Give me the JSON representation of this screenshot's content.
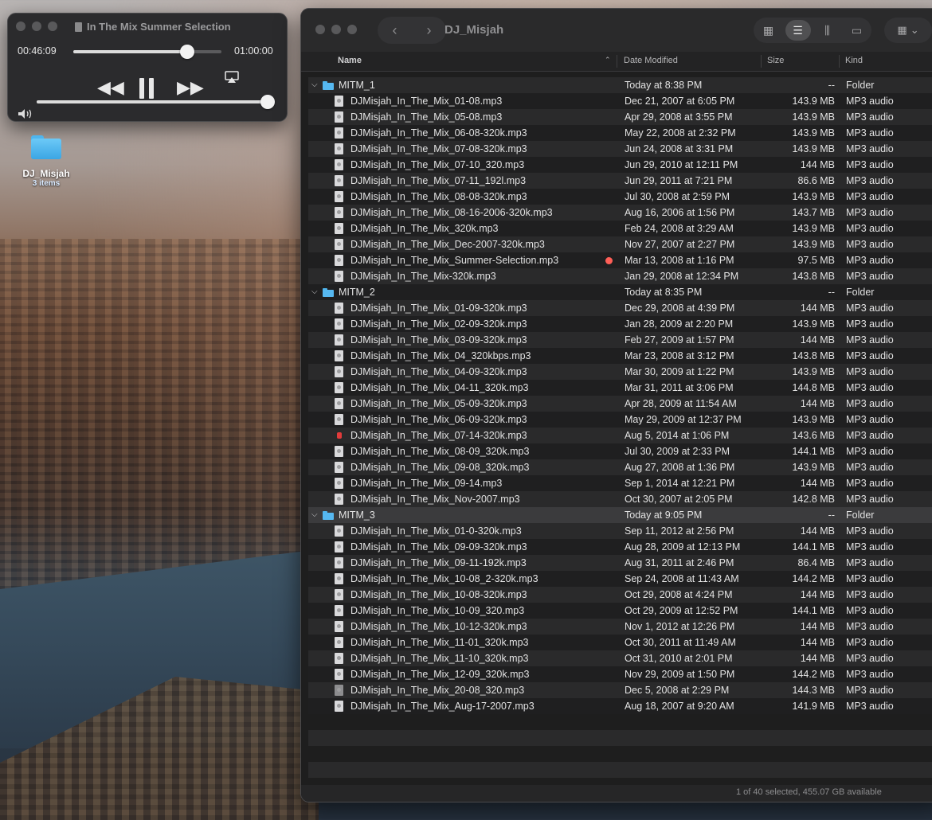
{
  "player": {
    "title": "In The Mix Summer Selection",
    "elapsed": "00:46:09",
    "duration": "01:00:00",
    "progress_fraction": 0.77,
    "volume_fraction": 1.0,
    "icons": {
      "rewind": "rewind-icon",
      "pause": "pause-icon",
      "forward": "fast-forward-icon",
      "airplay": "airplay-icon",
      "volume": "volume-icon"
    }
  },
  "desktop": {
    "folder_name": "DJ_Misjah",
    "folder_count": "3 items"
  },
  "finder": {
    "title": "DJ_Misjah",
    "columns": {
      "name": "Name",
      "date": "Date Modified",
      "size": "Size",
      "kind": "Kind"
    },
    "status": "1 of 40 selected, 455.07 GB available",
    "rows": [
      {
        "type": "folder",
        "name": "MITM_1",
        "date": "Today at 8:38 PM",
        "size": "--",
        "kind": "Folder"
      },
      {
        "type": "file",
        "name": "DJMisjah_In_The_Mix_01-08.mp3",
        "date": "Dec 21, 2007 at 6:05 PM",
        "size": "143.9 MB",
        "kind": "MP3 audio"
      },
      {
        "type": "file",
        "name": "DJMisjah_In_The_Mix_05-08.mp3",
        "date": "Apr 29, 2008 at 3:55 PM",
        "size": "143.9 MB",
        "kind": "MP3 audio"
      },
      {
        "type": "file",
        "name": "DJMisjah_In_The_Mix_06-08-320k.mp3",
        "date": "May 22, 2008 at 2:32 PM",
        "size": "143.9 MB",
        "kind": "MP3 audio"
      },
      {
        "type": "file",
        "name": "DJMisjah_In_The_Mix_07-08-320k.mp3",
        "date": "Jun 24, 2008 at 3:31 PM",
        "size": "143.9 MB",
        "kind": "MP3 audio"
      },
      {
        "type": "file",
        "name": "DJMisjah_In_The_Mix_07-10_320.mp3",
        "date": "Jun 29, 2010 at 12:11 PM",
        "size": "144 MB",
        "kind": "MP3 audio"
      },
      {
        "type": "file",
        "name": "DJMisjah_In_The_Mix_07-11_192l.mp3",
        "date": "Jun 29, 2011 at 7:21 PM",
        "size": "86.6 MB",
        "kind": "MP3 audio"
      },
      {
        "type": "file",
        "name": "DJMisjah_In_The_Mix_08-08-320k.mp3",
        "date": "Jul 30, 2008 at 2:59 PM",
        "size": "143.9 MB",
        "kind": "MP3 audio"
      },
      {
        "type": "file",
        "name": "DJMisjah_In_The_Mix_08-16-2006-320k.mp3",
        "date": "Aug 16, 2006 at 1:56 PM",
        "size": "143.7 MB",
        "kind": "MP3 audio"
      },
      {
        "type": "file",
        "name": "DJMisjah_In_The_Mix_320k.mp3",
        "date": "Feb 24, 2008 at 3:29 AM",
        "size": "143.9 MB",
        "kind": "MP3 audio"
      },
      {
        "type": "file",
        "name": "DJMisjah_In_The_Mix_Dec-2007-320k.mp3",
        "date": "Nov 27, 2007 at 2:27 PM",
        "size": "143.9 MB",
        "kind": "MP3 audio"
      },
      {
        "type": "file",
        "name": "DJMisjah_In_The_Mix_Summer-Selection.mp3",
        "date": "Mar 13, 2008 at 1:16 PM",
        "size": "97.5 MB",
        "kind": "MP3 audio",
        "tag": "red"
      },
      {
        "type": "file",
        "name": "DJMisjah_In_The_Mix-320k.mp3",
        "date": "Jan 29, 2008 at 12:34 PM",
        "size": "143.8 MB",
        "kind": "MP3 audio"
      },
      {
        "type": "folder",
        "name": "MITM_2",
        "date": "Today at 8:35 PM",
        "size": "--",
        "kind": "Folder"
      },
      {
        "type": "file",
        "name": "DJMisjah_In_The_Mix_01-09-320k.mp3",
        "date": "Dec 29, 2008 at 4:39 PM",
        "size": "144 MB",
        "kind": "MP3 audio"
      },
      {
        "type": "file",
        "name": "DJMisjah_In_The_Mix_02-09-320k.mp3",
        "date": "Jan 28, 2009 at 2:20 PM",
        "size": "143.9 MB",
        "kind": "MP3 audio"
      },
      {
        "type": "file",
        "name": "DJMisjah_In_The_Mix_03-09-320k.mp3",
        "date": "Feb 27, 2009 at 1:57 PM",
        "size": "144 MB",
        "kind": "MP3 audio"
      },
      {
        "type": "file",
        "name": "DJMisjah_In_The_Mix_04_320kbps.mp3",
        "date": "Mar 23, 2008 at 3:12 PM",
        "size": "143.8 MB",
        "kind": "MP3 audio"
      },
      {
        "type": "file",
        "name": "DJMisjah_In_The_Mix_04-09-320k.mp3",
        "date": "Mar 30, 2009 at 1:22 PM",
        "size": "143.9 MB",
        "kind": "MP3 audio"
      },
      {
        "type": "file",
        "name": "DJMisjah_In_The_Mix_04-11_320k.mp3",
        "date": "Mar 31, 2011 at 3:06 PM",
        "size": "144.8 MB",
        "kind": "MP3 audio"
      },
      {
        "type": "file",
        "name": "DJMisjah_In_The_Mix_05-09-320k.mp3",
        "date": "Apr 28, 2009 at 11:54 AM",
        "size": "144 MB",
        "kind": "MP3 audio"
      },
      {
        "type": "file",
        "name": "DJMisjah_In_The_Mix_06-09-320k.mp3",
        "date": "May 29, 2009 at 12:37 PM",
        "size": "143.9 MB",
        "kind": "MP3 audio"
      },
      {
        "type": "file",
        "name": "DJMisjah_In_The_Mix_07-14-320k.mp3",
        "date": "Aug 5, 2014 at 1:06 PM",
        "size": "143.6 MB",
        "kind": "MP3 audio",
        "icon": "red"
      },
      {
        "type": "file",
        "name": "DJMisjah_In_The_Mix_08-09_320k.mp3",
        "date": "Jul 30, 2009 at 2:33 PM",
        "size": "144.1 MB",
        "kind": "MP3 audio"
      },
      {
        "type": "file",
        "name": "DJMisjah_In_The_Mix_09-08_320k.mp3",
        "date": "Aug 27, 2008 at 1:36 PM",
        "size": "143.9 MB",
        "kind": "MP3 audio"
      },
      {
        "type": "file",
        "name": "DJMisjah_In_The_Mix_09-14.mp3",
        "date": "Sep 1, 2014 at 12:21 PM",
        "size": "144 MB",
        "kind": "MP3 audio"
      },
      {
        "type": "file",
        "name": "DJMisjah_In_The_Mix_Nov-2007.mp3",
        "date": "Oct 30, 2007 at 2:05 PM",
        "size": "142.8 MB",
        "kind": "MP3 audio"
      },
      {
        "type": "folder",
        "name": "MITM_3",
        "date": "Today at 9:05 PM",
        "size": "--",
        "kind": "Folder",
        "highlight": true
      },
      {
        "type": "file",
        "name": "DJMisjah_In_The_Mix_01-0-320k.mp3",
        "date": "Sep 11, 2012 at 2:56 PM",
        "size": "144 MB",
        "kind": "MP3 audio"
      },
      {
        "type": "file",
        "name": "DJMisjah_In_The_Mix_09-09-320k.mp3",
        "date": "Aug 28, 2009 at 12:13 PM",
        "size": "144.1 MB",
        "kind": "MP3 audio"
      },
      {
        "type": "file",
        "name": "DJMisjah_In_The_Mix_09-11-192k.mp3",
        "date": "Aug 31, 2011 at 2:46 PM",
        "size": "86.4 MB",
        "kind": "MP3 audio"
      },
      {
        "type": "file",
        "name": "DJMisjah_In_The_Mix_10-08_2-320k.mp3",
        "date": "Sep 24, 2008 at 11:43 AM",
        "size": "144.2 MB",
        "kind": "MP3 audio"
      },
      {
        "type": "file",
        "name": "DJMisjah_In_The_Mix_10-08-320k.mp3",
        "date": "Oct 29, 2008 at 4:24 PM",
        "size": "144 MB",
        "kind": "MP3 audio"
      },
      {
        "type": "file",
        "name": "DJMisjah_In_The_Mix_10-09_320.mp3",
        "date": "Oct 29, 2009 at 12:52 PM",
        "size": "144.1 MB",
        "kind": "MP3 audio"
      },
      {
        "type": "file",
        "name": "DJMisjah_In_The_Mix_10-12-320k.mp3",
        "date": "Nov 1, 2012 at 12:26 PM",
        "size": "144 MB",
        "kind": "MP3 audio"
      },
      {
        "type": "file",
        "name": "DJMisjah_In_The_Mix_11-01_320k.mp3",
        "date": "Oct 30, 2011 at 11:49 AM",
        "size": "144 MB",
        "kind": "MP3 audio"
      },
      {
        "type": "file",
        "name": "DJMisjah_In_The_Mix_11-10_320k.mp3",
        "date": "Oct 31, 2010 at 2:01 PM",
        "size": "144 MB",
        "kind": "MP3 audio"
      },
      {
        "type": "file",
        "name": "DJMisjah_In_The_Mix_12-09_320k.mp3",
        "date": "Nov 29, 2009 at 1:50 PM",
        "size": "144.2 MB",
        "kind": "MP3 audio"
      },
      {
        "type": "file",
        "name": "DJMisjah_In_The_Mix_20-08_320.mp3",
        "date": "Dec 5, 2008 at 2:29 PM",
        "size": "144.3 MB",
        "kind": "MP3 audio",
        "icon": "dark"
      },
      {
        "type": "file",
        "name": "DJMisjah_In_The_Mix_Aug-17-2007.mp3",
        "date": "Aug 18, 2007 at 9:20 AM",
        "size": "141.9 MB",
        "kind": "MP3 audio"
      }
    ]
  }
}
